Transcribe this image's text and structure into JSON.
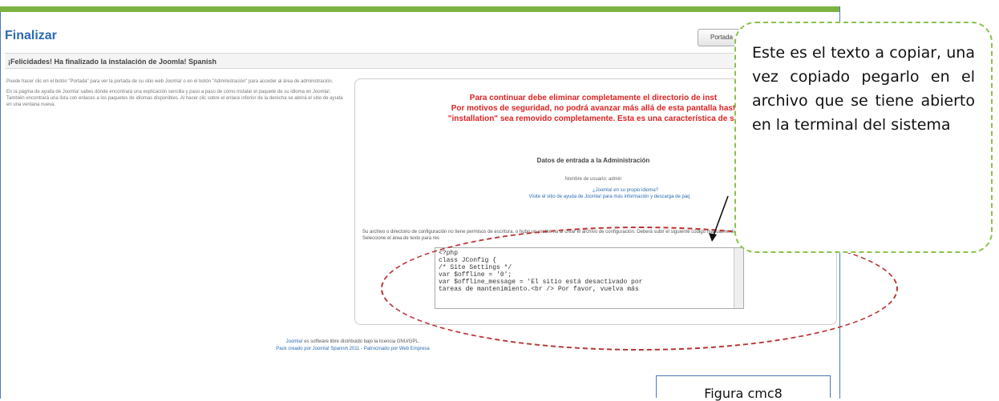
{
  "page": {
    "title": "Finalizar",
    "prev_button": "Portada",
    "subheading": "¡Felicidades! Ha finalizado la instalación de Joomla! Spanish"
  },
  "left_text": [
    "Puede hacer clic en el botón \"Portada\" para ver la portada de su sitio web Joomla! o en el botón \"Administración\" para acceder al área de administración.",
    "En la página de ayuda de Joomla! sabes dónde encontrará una explicación sencilla y paso a paso de cómo instalar el paquete de su idioma en Joomla!. También encontrará una lista con enlaces a los paquetes de idiomas disponibles. Al hacer clic sobre el enlace inferior de la derecha se abrirá el sitio de ayuda en una ventana nueva."
  ],
  "panel": {
    "warning_lines": [
      "Para continuar debe eliminar completamente el directorio de inst",
      "Por motivos de seguridad, no podrá avanzar más allá de esta pantalla hast",
      "\"installation\" sea removido completamente. Esta es una característica de se"
    ],
    "admin_heading": "Datos de entrada a la Administración",
    "admin_user": "Nombre de usuario: admin",
    "help_link": "¿Joomla! en su propio idioma?",
    "help_link_2": "Visite el sitio de ayuda de Joomla! para más información y descarga de paq",
    "config_note": "Su archivo o directorio de configuración no tiene permisos de escritura, o hubo un problema al crear el archivo de configuración. Deberá subir el siguiente código manualmente. Seleccione el área de texto para res",
    "code_lines": [
      "<?php",
      "class JConfig {",
      "/* Site Settings */",
      "var $offline = '0';",
      "var $offline_message = 'El sitio está desactivado por",
      "tareas de mantenimiento.<br /> Por favor, vuelva más"
    ]
  },
  "footer": {
    "line1_a": "Joomla!",
    "line1_b": " es software libre distribuido bajo la licencia GNU/GPL.",
    "line2": "Pack creado por Joomla! Spanish 2011 - Patrocinado por Web Empresa"
  },
  "callout": {
    "text": "Este es el texto a copiar, una vez copiado pegarlo en el archivo que se tiene abierto en la terminal del sistema"
  },
  "caption": {
    "text": "Figura cmc8"
  },
  "colors": {
    "green_bar": "#7cb342",
    "title_blue": "#2b6bb5",
    "warning_red": "#dd2222",
    "callout_border": "#8bc34a",
    "oval_border": "#bb3333"
  }
}
